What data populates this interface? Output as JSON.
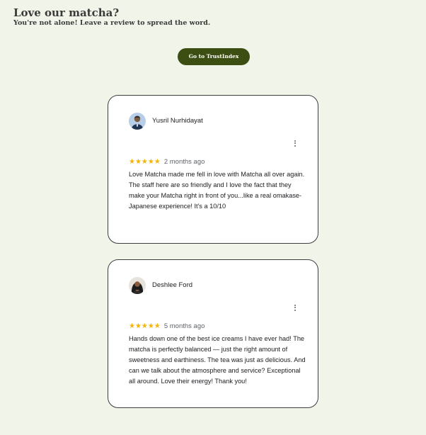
{
  "header": {
    "title": "Love our matcha?",
    "subtitle": "You're not alone! Leave a review to spread the word."
  },
  "cta": {
    "label": "Go to TrustIndex"
  },
  "reviews": [
    {
      "author": "Yusril Nurhidayat",
      "rating": 5,
      "stars": "★★★★★",
      "time": "2 months ago",
      "text": "Love Matcha made me fell in love with Matcha all over again. The staff here are so friendly and I love the fact that they make your Matcha right in front of you...like a real omakase-Japanese experience! It's a 10/10",
      "avatar_icon": "person-avatar-icon"
    },
    {
      "author": "Deshlee Ford",
      "rating": 5,
      "stars": "★★★★★",
      "time": "5 months ago",
      "text": "Hands down one of the best ice creams I have ever had! The matcha is perfectly balanced — just the right amount of sweetness and earthiness. The tea was just as delicious. And can we talk about the atmosphere and service? Exceptional all around. Love their energy! Thank you!",
      "avatar_icon": "person-avatar-icon"
    }
  ],
  "colors": {
    "background": "#f1f4e9",
    "button": "#3c4e12",
    "star": "#f4b400",
    "card_border": "#3d3d3d"
  },
  "icons": {
    "more": "more-vertical-icon",
    "star": "star-icon"
  }
}
